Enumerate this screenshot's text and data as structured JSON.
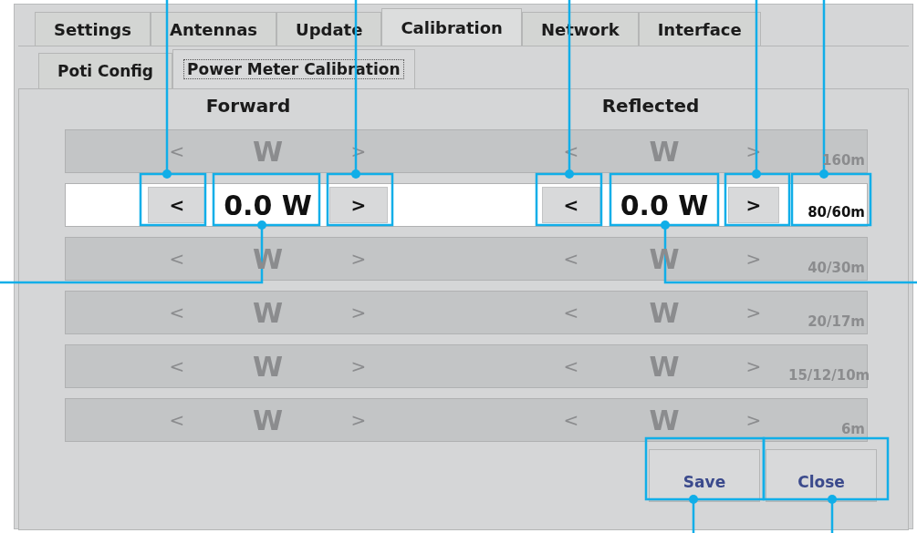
{
  "tabs": [
    {
      "label": "Settings",
      "selected": false
    },
    {
      "label": "Antennas",
      "selected": false
    },
    {
      "label": "Update",
      "selected": false
    },
    {
      "label": "Calibration",
      "selected": true
    },
    {
      "label": "Network",
      "selected": false
    },
    {
      "label": "Interface",
      "selected": false
    }
  ],
  "subtabs": [
    {
      "label": "Poti Config",
      "selected": false
    },
    {
      "label": "Power Meter Calibration",
      "selected": true
    }
  ],
  "headers": {
    "forward": "Forward",
    "reflected": "Reflected"
  },
  "rows": [
    {
      "decrease_forward": "<",
      "forward": "W",
      "increase_forward": ">",
      "decrease_reflected": "<",
      "reflected": "W",
      "increase_reflected": ">",
      "band": "160m",
      "enabled": false
    },
    {
      "decrease_forward": "<",
      "forward": "0.0 W",
      "increase_forward": ">",
      "decrease_reflected": "<",
      "reflected": "0.0 W",
      "increase_reflected": ">",
      "band": "80/60m",
      "enabled": true
    },
    {
      "decrease_forward": "<",
      "forward": "W",
      "increase_forward": ">",
      "decrease_reflected": "<",
      "reflected": "W",
      "increase_reflected": ">",
      "band": "40/30m",
      "enabled": false
    },
    {
      "decrease_forward": "<",
      "forward": "W",
      "increase_forward": ">",
      "decrease_reflected": "<",
      "reflected": "W",
      "increase_reflected": ">",
      "band": "20/17m",
      "enabled": false
    },
    {
      "decrease_forward": "<",
      "forward": "W",
      "increase_forward": ">",
      "decrease_reflected": "<",
      "reflected": "W",
      "increase_reflected": ">",
      "band": "15/12/10m",
      "enabled": false
    },
    {
      "decrease_forward": "<",
      "forward": "W",
      "increase_forward": ">",
      "decrease_reflected": "<",
      "reflected": "W",
      "increase_reflected": ">",
      "band": "6m",
      "enabled": false
    }
  ],
  "buttons": [
    "Save",
    "Close"
  ]
}
